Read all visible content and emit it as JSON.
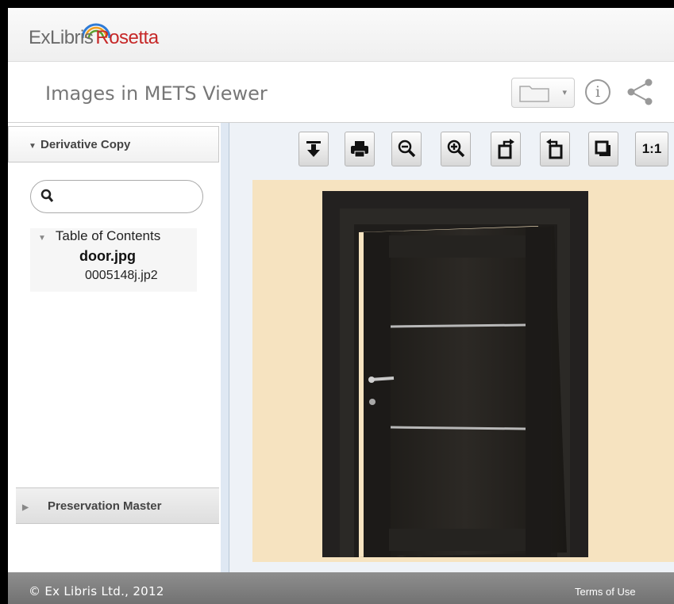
{
  "logo": {
    "ex_text": "ExLibris",
    "rosetta_text": "Rosetta"
  },
  "header": {
    "title": "Images in METS Viewer"
  },
  "header_icons": {
    "folder": "folder-icon",
    "info": "info-icon",
    "share": "share-icon"
  },
  "sidebar": {
    "derivative_label": "Derivative Copy",
    "search_placeholder": "",
    "toc": {
      "heading": "Table of Contents",
      "file": "door.jpg",
      "subfile": "0005148j.jp2"
    },
    "preservation_label": "Preservation Master"
  },
  "toolbar": {
    "buttons": [
      "download-icon",
      "print-icon",
      "zoom-out-icon",
      "zoom-in-icon",
      "rotate-left-icon",
      "rotate-right-icon",
      "fit-window-icon"
    ],
    "actual_size_label": "1:1"
  },
  "footer": {
    "copyright": "© Ex Libris Ltd., 2012",
    "terms": "Terms of Use"
  },
  "colors": {
    "brand_red": "#c62828",
    "image_bg": "#f6e3c0",
    "footer_bg": "#7f7f7f"
  }
}
